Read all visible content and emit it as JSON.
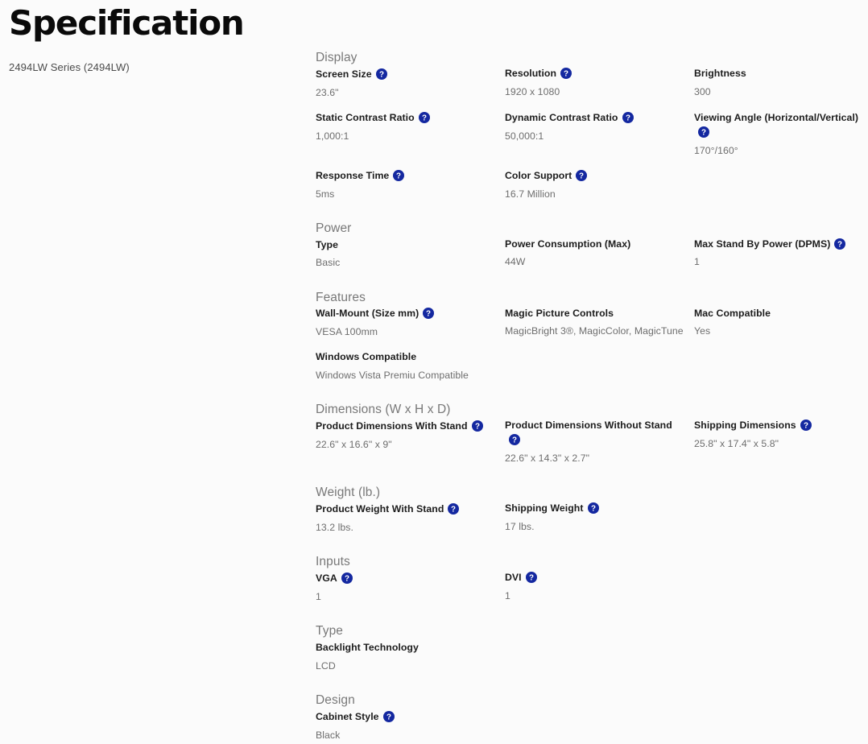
{
  "page": {
    "title": "Specification",
    "subtitle": "2494LW Series (2494LW)"
  },
  "colors": {
    "help_icon_bg": "#1428a0",
    "help_icon_fg": "#ffffff",
    "section_head": "#787878",
    "label": "#1c1c1c",
    "value": "#6e6e6e",
    "background": "#fbfbfb"
  },
  "icons": {
    "help": "help-icon"
  },
  "sections": [
    {
      "name": "Display",
      "rows": [
        [
          {
            "label": "Screen Size",
            "help": true,
            "value": "23.6\""
          },
          {
            "label": "Resolution",
            "help": true,
            "value": "1920 x 1080"
          },
          {
            "label": "Brightness",
            "help": false,
            "value": "300"
          }
        ],
        [
          {
            "label": "Static Contrast Ratio",
            "help": true,
            "value": "1,000:1"
          },
          {
            "label": "Dynamic Contrast Ratio",
            "help": true,
            "value": "50,000:1"
          },
          {
            "label": "Viewing Angle (Horizontal/Vertical)",
            "help": true,
            "value": "170°/160°"
          }
        ],
        [
          {
            "label": "Response Time",
            "help": true,
            "value": "5ms"
          },
          {
            "label": "Color Support",
            "help": true,
            "value": "16.7 Million"
          },
          {
            "label": "",
            "help": false,
            "value": ""
          }
        ]
      ]
    },
    {
      "name": "Power",
      "rows": [
        [
          {
            "label": "Type",
            "help": false,
            "value": "Basic"
          },
          {
            "label": "Power Consumption (Max)",
            "help": false,
            "value": "44W"
          },
          {
            "label": "Max Stand By Power (DPMS)",
            "help": true,
            "value": "1"
          }
        ]
      ]
    },
    {
      "name": "Features",
      "rows": [
        [
          {
            "label": "Wall-Mount (Size mm)",
            "help": true,
            "value": "VESA 100mm"
          },
          {
            "label": "Magic Picture Controls",
            "help": false,
            "value": "MagicBright 3®, MagicColor, MagicTune"
          },
          {
            "label": "Mac Compatible",
            "help": false,
            "value": "Yes"
          }
        ],
        [
          {
            "label": "Windows Compatible",
            "help": false,
            "value": "Windows Vista Premiu Compatible"
          },
          {
            "label": "",
            "help": false,
            "value": ""
          },
          {
            "label": "",
            "help": false,
            "value": ""
          }
        ]
      ]
    },
    {
      "name": "Dimensions (W x H x D)",
      "rows": [
        [
          {
            "label": "Product Dimensions With Stand",
            "help": true,
            "value": "22.6\" x 16.6\" x 9\""
          },
          {
            "label": "Product Dimensions Without Stand",
            "help": true,
            "value": "22.6\" x 14.3\" x 2.7\""
          },
          {
            "label": "Shipping Dimensions",
            "help": true,
            "value": "25.8\" x 17.4\" x 5.8\""
          }
        ]
      ]
    },
    {
      "name": "Weight (lb.)",
      "rows": [
        [
          {
            "label": "Product Weight With Stand",
            "help": true,
            "value": "13.2 lbs."
          },
          {
            "label": "Shipping Weight",
            "help": true,
            "value": "17 lbs."
          },
          {
            "label": "",
            "help": false,
            "value": ""
          }
        ]
      ]
    },
    {
      "name": "Inputs",
      "rows": [
        [
          {
            "label": "VGA",
            "help": true,
            "value": "1"
          },
          {
            "label": "DVI",
            "help": true,
            "value": "1"
          },
          {
            "label": "",
            "help": false,
            "value": ""
          }
        ]
      ]
    },
    {
      "name": "Type",
      "rows": [
        [
          {
            "label": "Backlight Technology",
            "help": false,
            "value": "LCD"
          },
          {
            "label": "",
            "help": false,
            "value": ""
          },
          {
            "label": "",
            "help": false,
            "value": ""
          }
        ]
      ]
    },
    {
      "name": "Design",
      "rows": [
        [
          {
            "label": "Cabinet Style",
            "help": true,
            "value": "Black"
          },
          {
            "label": "",
            "help": false,
            "value": ""
          },
          {
            "label": "",
            "help": false,
            "value": ""
          }
        ]
      ]
    }
  ]
}
